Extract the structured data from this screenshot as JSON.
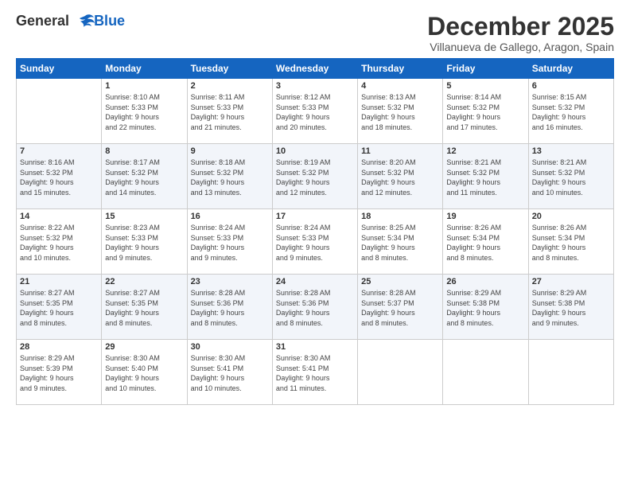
{
  "logo": {
    "line1": "General",
    "line2": "Blue"
  },
  "title": "December 2025",
  "location": "Villanueva de Gallego, Aragon, Spain",
  "days_header": [
    "Sunday",
    "Monday",
    "Tuesday",
    "Wednesday",
    "Thursday",
    "Friday",
    "Saturday"
  ],
  "weeks": [
    [
      {
        "day": "",
        "info": ""
      },
      {
        "day": "1",
        "info": "Sunrise: 8:10 AM\nSunset: 5:33 PM\nDaylight: 9 hours\nand 22 minutes."
      },
      {
        "day": "2",
        "info": "Sunrise: 8:11 AM\nSunset: 5:33 PM\nDaylight: 9 hours\nand 21 minutes."
      },
      {
        "day": "3",
        "info": "Sunrise: 8:12 AM\nSunset: 5:33 PM\nDaylight: 9 hours\nand 20 minutes."
      },
      {
        "day": "4",
        "info": "Sunrise: 8:13 AM\nSunset: 5:32 PM\nDaylight: 9 hours\nand 18 minutes."
      },
      {
        "day": "5",
        "info": "Sunrise: 8:14 AM\nSunset: 5:32 PM\nDaylight: 9 hours\nand 17 minutes."
      },
      {
        "day": "6",
        "info": "Sunrise: 8:15 AM\nSunset: 5:32 PM\nDaylight: 9 hours\nand 16 minutes."
      }
    ],
    [
      {
        "day": "7",
        "info": "Sunrise: 8:16 AM\nSunset: 5:32 PM\nDaylight: 9 hours\nand 15 minutes."
      },
      {
        "day": "8",
        "info": "Sunrise: 8:17 AM\nSunset: 5:32 PM\nDaylight: 9 hours\nand 14 minutes."
      },
      {
        "day": "9",
        "info": "Sunrise: 8:18 AM\nSunset: 5:32 PM\nDaylight: 9 hours\nand 13 minutes."
      },
      {
        "day": "10",
        "info": "Sunrise: 8:19 AM\nSunset: 5:32 PM\nDaylight: 9 hours\nand 12 minutes."
      },
      {
        "day": "11",
        "info": "Sunrise: 8:20 AM\nSunset: 5:32 PM\nDaylight: 9 hours\nand 12 minutes."
      },
      {
        "day": "12",
        "info": "Sunrise: 8:21 AM\nSunset: 5:32 PM\nDaylight: 9 hours\nand 11 minutes."
      },
      {
        "day": "13",
        "info": "Sunrise: 8:21 AM\nSunset: 5:32 PM\nDaylight: 9 hours\nand 10 minutes."
      }
    ],
    [
      {
        "day": "14",
        "info": "Sunrise: 8:22 AM\nSunset: 5:32 PM\nDaylight: 9 hours\nand 10 minutes."
      },
      {
        "day": "15",
        "info": "Sunrise: 8:23 AM\nSunset: 5:33 PM\nDaylight: 9 hours\nand 9 minutes."
      },
      {
        "day": "16",
        "info": "Sunrise: 8:24 AM\nSunset: 5:33 PM\nDaylight: 9 hours\nand 9 minutes."
      },
      {
        "day": "17",
        "info": "Sunrise: 8:24 AM\nSunset: 5:33 PM\nDaylight: 9 hours\nand 9 minutes."
      },
      {
        "day": "18",
        "info": "Sunrise: 8:25 AM\nSunset: 5:34 PM\nDaylight: 9 hours\nand 8 minutes."
      },
      {
        "day": "19",
        "info": "Sunrise: 8:26 AM\nSunset: 5:34 PM\nDaylight: 9 hours\nand 8 minutes."
      },
      {
        "day": "20",
        "info": "Sunrise: 8:26 AM\nSunset: 5:34 PM\nDaylight: 9 hours\nand 8 minutes."
      }
    ],
    [
      {
        "day": "21",
        "info": "Sunrise: 8:27 AM\nSunset: 5:35 PM\nDaylight: 9 hours\nand 8 minutes."
      },
      {
        "day": "22",
        "info": "Sunrise: 8:27 AM\nSunset: 5:35 PM\nDaylight: 9 hours\nand 8 minutes."
      },
      {
        "day": "23",
        "info": "Sunrise: 8:28 AM\nSunset: 5:36 PM\nDaylight: 9 hours\nand 8 minutes."
      },
      {
        "day": "24",
        "info": "Sunrise: 8:28 AM\nSunset: 5:36 PM\nDaylight: 9 hours\nand 8 minutes."
      },
      {
        "day": "25",
        "info": "Sunrise: 8:28 AM\nSunset: 5:37 PM\nDaylight: 9 hours\nand 8 minutes."
      },
      {
        "day": "26",
        "info": "Sunrise: 8:29 AM\nSunset: 5:38 PM\nDaylight: 9 hours\nand 8 minutes."
      },
      {
        "day": "27",
        "info": "Sunrise: 8:29 AM\nSunset: 5:38 PM\nDaylight: 9 hours\nand 9 minutes."
      }
    ],
    [
      {
        "day": "28",
        "info": "Sunrise: 8:29 AM\nSunset: 5:39 PM\nDaylight: 9 hours\nand 9 minutes."
      },
      {
        "day": "29",
        "info": "Sunrise: 8:30 AM\nSunset: 5:40 PM\nDaylight: 9 hours\nand 10 minutes."
      },
      {
        "day": "30",
        "info": "Sunrise: 8:30 AM\nSunset: 5:41 PM\nDaylight: 9 hours\nand 10 minutes."
      },
      {
        "day": "31",
        "info": "Sunrise: 8:30 AM\nSunset: 5:41 PM\nDaylight: 9 hours\nand 11 minutes."
      },
      {
        "day": "",
        "info": ""
      },
      {
        "day": "",
        "info": ""
      },
      {
        "day": "",
        "info": ""
      }
    ]
  ]
}
